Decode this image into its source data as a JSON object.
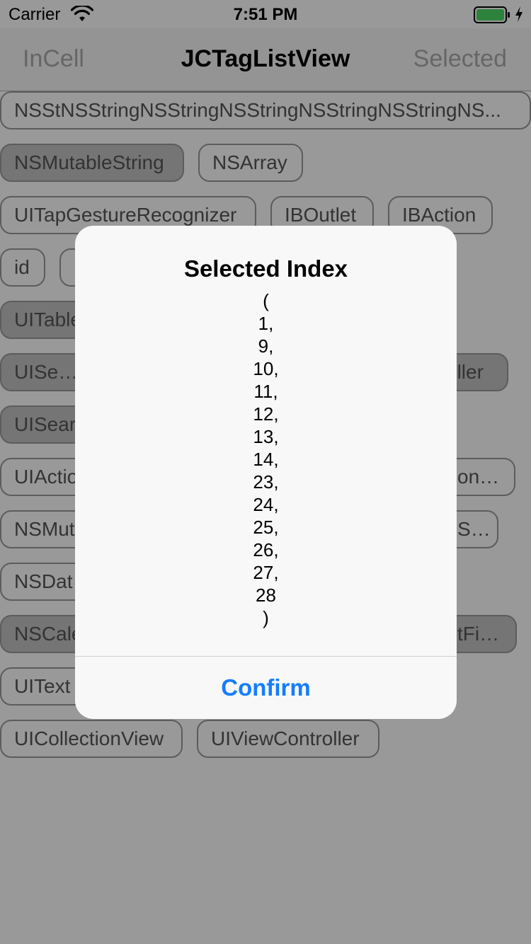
{
  "status_bar": {
    "carrier": "Carrier",
    "time": "7:51 PM",
    "battery_color": "#4cd964",
    "icons": [
      "wifi-icon",
      "battery-icon",
      "charging-icon"
    ]
  },
  "nav": {
    "left": "InCell",
    "title": "JCTagListView",
    "right": "Selected"
  },
  "tags": [
    {
      "label": "NSStNSStringNSStringNSStringNSStringNSStringNS...",
      "selected": false
    },
    {
      "label": "NSMutableString",
      "selected": true
    },
    {
      "label": "NSArray",
      "selected": false
    },
    {
      "label": "UITapGestureRecognizer",
      "selected": false
    },
    {
      "label": "IBOutlet",
      "selected": false
    },
    {
      "label": "IBAction",
      "selected": false
    },
    {
      "label": "id",
      "selected": false
    },
    {
      "label": "",
      "selected": false
    },
    {
      "label": "UITable",
      "selected": true
    },
    {
      "label": "UISegm",
      "selected": true
    },
    {
      "label": "oller",
      "selected": true
    },
    {
      "label": "UISear",
      "selected": true
    },
    {
      "label": "UIActio",
      "selected": false
    },
    {
      "label": "onary",
      "selected": false
    },
    {
      "label": "NSMut",
      "selected": false
    },
    {
      "label": "Set",
      "selected": false
    },
    {
      "label": "NSDat",
      "selected": false
    },
    {
      "label": "NSCale",
      "selected": true
    },
    {
      "label": "tField",
      "selected": true
    },
    {
      "label": "UIText",
      "selected": false
    },
    {
      "label": "UICollectionView",
      "selected": false
    },
    {
      "label": "UIViewController",
      "selected": false
    }
  ],
  "alert": {
    "title": "Selected Index",
    "lines": [
      "(",
      "1,",
      "9,",
      "10,",
      "11,",
      "12,",
      "13,",
      "14,",
      "23,",
      "24,",
      "25,",
      "26,",
      "27,",
      "28",
      ")"
    ],
    "confirm": "Confirm",
    "confirm_color": "#147efb"
  }
}
